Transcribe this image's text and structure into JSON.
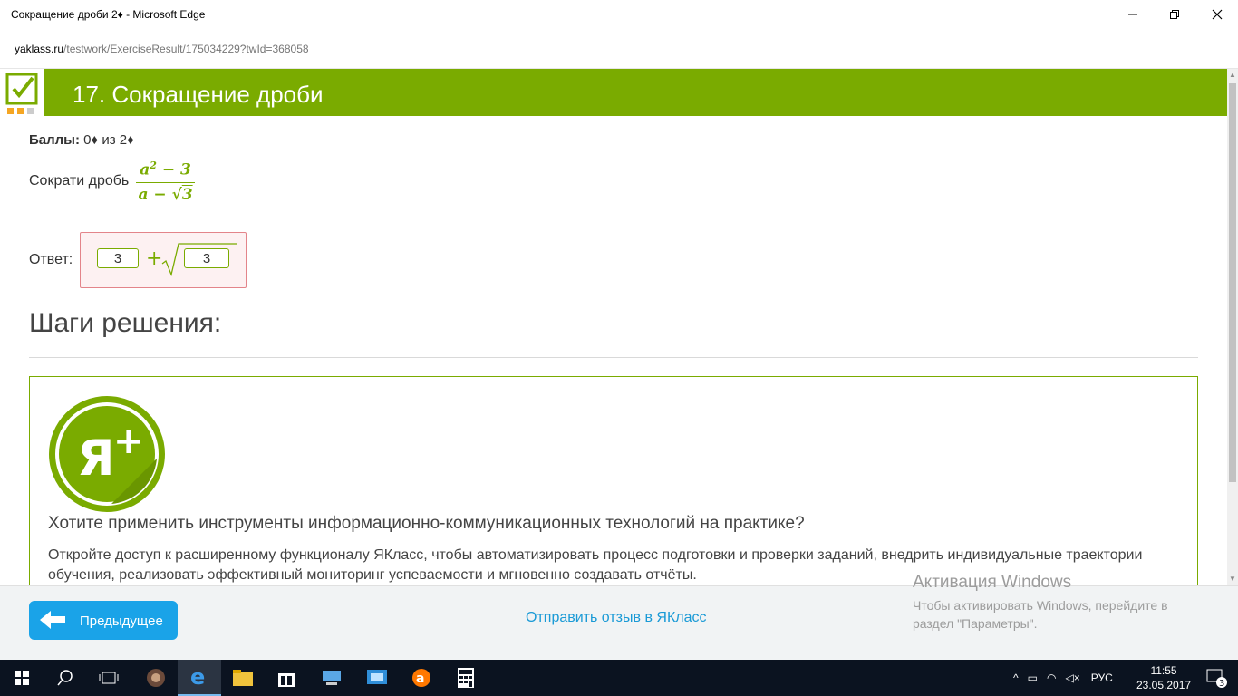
{
  "window": {
    "title": "Сокращение дроби 2♦ - Microsoft Edge",
    "url_host": "yaklass.ru",
    "url_path": "/testwork/ExerciseResult/175034229?twId=368058"
  },
  "page": {
    "header_title": "17. Сокращение дроби",
    "score_label": "Баллы:",
    "score_value": "0♦ из 2♦",
    "task_text": "Сократи дробь",
    "fraction": {
      "num_base": "a",
      "num_exp": "2",
      "num_rest": " − 3",
      "den_left": "a − ",
      "den_sqrt": "3"
    },
    "answer_label": "Ответ:",
    "answer_values": [
      "3",
      "3"
    ],
    "answer_plus": "+",
    "steps_title": "Шаги решения:",
    "promo": {
      "heading": "Хотите применить инструменты информационно-коммуникационных технологий на практике?",
      "text": "Откройте доступ к расширенному функционалу ЯКласс, чтобы автоматизировать процесс подготовки и проверки заданий, внедрить индивидуальные траектории обучения, реализовать эффективный мониторинг успеваемости и мгновенно создавать отчёты.",
      "badge_text": "Я+"
    }
  },
  "footer": {
    "prev_button": "Предыдущее",
    "feedback_link": "Отправить отзыв в ЯКласс"
  },
  "activation": {
    "title": "Активация Windows",
    "text": "Чтобы активировать Windows, перейдите в раздел \"Параметры\"."
  },
  "taskbar": {
    "lang": "РУС",
    "time": "11:55",
    "date": "23.05.2017",
    "notifications": "3",
    "icons": [
      "start-icon",
      "search-icon",
      "task-view-icon",
      "media-app-icon",
      "edge-icon",
      "file-explorer-icon",
      "store-icon",
      "computer-app-icon",
      "remote-app-icon",
      "avast-icon",
      "calculator-icon"
    ]
  },
  "colors": {
    "accent_green": "#7aab00",
    "button_blue": "#1aa3e8",
    "error_border": "#e3848a"
  }
}
